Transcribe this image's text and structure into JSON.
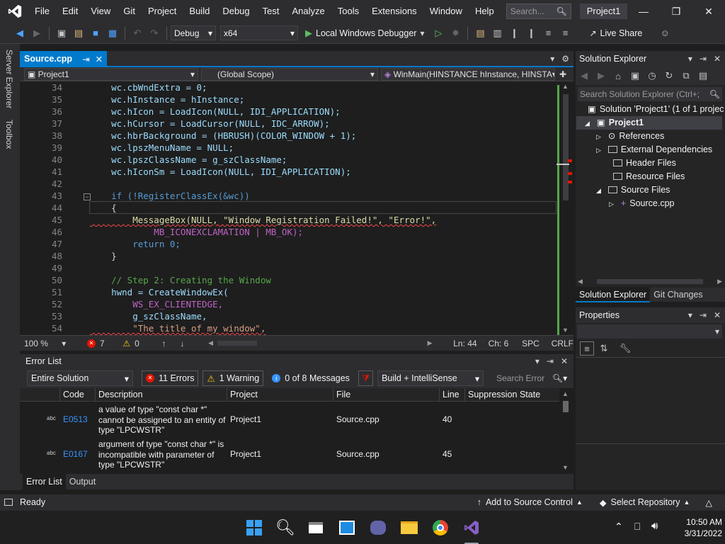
{
  "menu": {
    "items": [
      "File",
      "Edit",
      "View",
      "Git",
      "Project",
      "Build",
      "Debug",
      "Test",
      "Analyze",
      "Tools",
      "Extensions",
      "Window",
      "Help"
    ],
    "search_placeholder": "Search...",
    "project_name": "Project1"
  },
  "toolbar": {
    "configuration": "Debug",
    "platform": "x64",
    "run_label": "Local Windows Debugger",
    "live_share": "Live Share"
  },
  "left_tabs": [
    "Server Explorer",
    "Toolbox"
  ],
  "editor": {
    "tab_label": "Source.cpp",
    "nav_project": "Project1",
    "nav_scope": "(Global Scope)",
    "nav_function": "WinMain(HINSTANCE hInstance, HINSTA",
    "zoom": "100 %",
    "error_count": "7",
    "warning_count": "0",
    "ln": "Ln: 44",
    "ch": "Ch: 6",
    "spc": "SPC",
    "eol": "CRLF"
  },
  "code_lines": [
    {
      "n": "34",
      "t": "    wc.cbWndExtra = 0;"
    },
    {
      "n": "35",
      "t": "    wc.hInstance = hInstance;"
    },
    {
      "n": "36",
      "t": "    wc.hIcon = LoadIcon(NULL, IDI_APPLICATION);"
    },
    {
      "n": "37",
      "t": "    wc.hCursor = LoadCursor(NULL, IDC_ARROW);"
    },
    {
      "n": "38",
      "t": "    wc.hbrBackground = (HBRUSH)(COLOR_WINDOW + 1);"
    },
    {
      "n": "39",
      "t": "    wc.lpszMenuName = NULL;"
    },
    {
      "n": "40",
      "t": "    wc.lpszClassName = g_szClassName;"
    },
    {
      "n": "41",
      "t": "    wc.hIconSm = LoadIcon(NULL, IDI_APPLICATION);"
    },
    {
      "n": "42",
      "t": ""
    },
    {
      "n": "43",
      "t": "    if (!RegisterClassEx(&wc))"
    },
    {
      "n": "44",
      "t": "    {"
    },
    {
      "n": "45",
      "t": "        MessageBox(NULL, \"Window Registration Failed!\", \"Error!\","
    },
    {
      "n": "46",
      "t": "            MB_ICONEXCLAMATION | MB_OK);"
    },
    {
      "n": "47",
      "t": "        return 0;"
    },
    {
      "n": "48",
      "t": "    }"
    },
    {
      "n": "49",
      "t": ""
    },
    {
      "n": "50",
      "t": "    // Step 2: Creating the Window"
    },
    {
      "n": "51",
      "t": "    hwnd = CreateWindowEx("
    },
    {
      "n": "52",
      "t": "        WS_EX_CLIENTEDGE,"
    },
    {
      "n": "53",
      "t": "        g_szClassName,"
    },
    {
      "n": "54",
      "t": "        \"The title of my window\","
    }
  ],
  "error_list": {
    "title": "Error List",
    "scope": "Entire Solution",
    "errors_btn": "11 Errors",
    "warnings_btn": "1 Warning",
    "messages_btn": "0 of 8 Messages",
    "source": "Build + IntelliSense",
    "search_placeholder": "Search Error",
    "columns": [
      "Code",
      "Description",
      "Project",
      "File",
      "Line",
      "Suppression State"
    ],
    "rows": [
      {
        "code": "E0513",
        "description": "a value of type \"const char *\" cannot be assigned to an entity of type \"LPCWSTR\"",
        "project": "Project1",
        "file": "Source.cpp",
        "line": "40"
      },
      {
        "code": "E0167",
        "description": "argument of type \"const char *\" is incompatible with parameter of type \"LPCWSTR\"",
        "project": "Project1",
        "file": "Source.cpp",
        "line": "45"
      }
    ],
    "bottom_tabs": [
      "Error List",
      "Output"
    ]
  },
  "solution_explorer": {
    "title": "Solution Explorer",
    "search_placeholder": "Search Solution Explorer (Ctrl+;",
    "solution": "Solution 'Project1' (1 of 1 projec",
    "project": "Project1",
    "items": [
      "References",
      "External Dependencies",
      "Header Files",
      "Resource Files",
      "Source Files",
      "Source.cpp"
    ],
    "tabs": [
      "Solution Explorer",
      "Git Changes"
    ]
  },
  "properties": {
    "title": "Properties"
  },
  "statusbar": {
    "ready": "Ready",
    "source_control": "Add to Source Control",
    "repository": "Select Repository"
  },
  "taskbar": {
    "time": "10:50 AM",
    "date": "3/31/2022"
  },
  "colors": {
    "accent": "#007acc",
    "error": "#e51400",
    "vs_purple": "#865fc5"
  }
}
